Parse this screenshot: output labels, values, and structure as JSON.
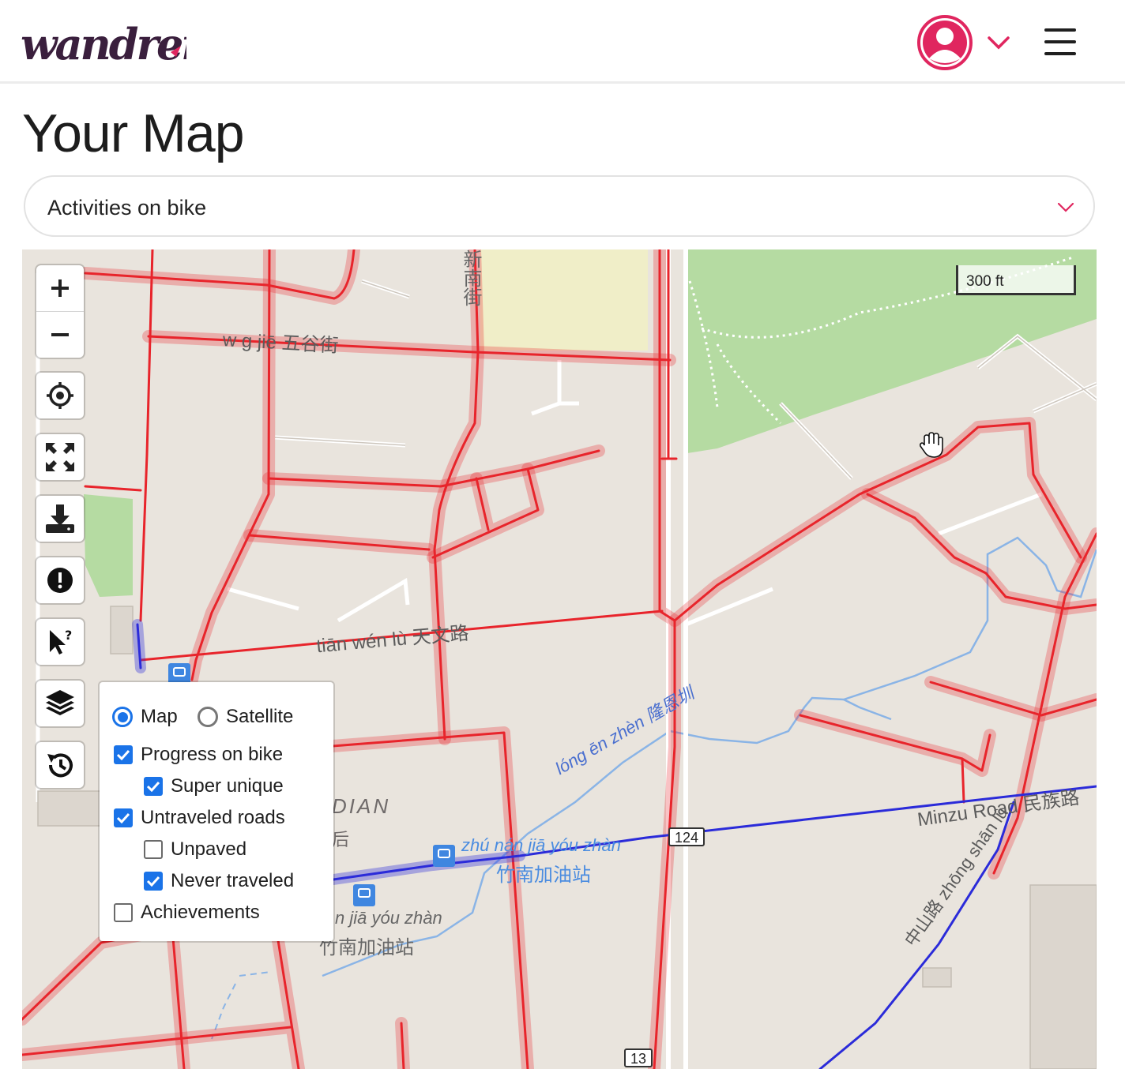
{
  "header": {
    "logo_text": "wandrer",
    "brand_color": "#3a1f3d",
    "accent_color": "#e0265f",
    "avatar_icon": "user-circle-icon",
    "menu_icon": "hamburger-icon"
  },
  "page": {
    "title": "Your Map"
  },
  "activity_select": {
    "value": "Activities on bike"
  },
  "map": {
    "scale_label": "300 ft",
    "controls": [
      {
        "name": "zoom-in",
        "icon": "plus-icon"
      },
      {
        "name": "zoom-out",
        "icon": "minus-icon"
      },
      {
        "name": "locate",
        "icon": "crosshair-icon"
      },
      {
        "name": "fullscreen",
        "icon": "expand-icon"
      },
      {
        "name": "download",
        "icon": "download-icon"
      },
      {
        "name": "report",
        "icon": "alert-icon"
      },
      {
        "name": "select-help",
        "icon": "cursor-question-icon"
      },
      {
        "name": "layers",
        "icon": "layers-icon"
      },
      {
        "name": "history",
        "icon": "history-icon"
      }
    ],
    "labels": {
      "street_xinnan": "新南街",
      "street_wugu": "w g jiē 五谷街",
      "street_tianwen": "tiān wén lù 天文路",
      "canal_longen": "lóng ēn zhèn 隆恩圳",
      "road_minzu": "Minzu Road 民族路",
      "station_pinyin": "zhú nán jiā yóu zhàn",
      "station_han": "竹南加油站",
      "station_pinyin_2": "n jiā yóu zhàn",
      "station_han_2": "竹南加油站",
      "district_fragment": "DIAN",
      "district_char": "后",
      "road_diagonal": "中山路 zhōng shān lù",
      "shield_124": "124",
      "shield_13": "13"
    },
    "colors": {
      "untraveled": "#e8242b",
      "progress": "#2b2bd9",
      "park": "#b5dba2",
      "land": "#e9e4dd",
      "water": "#8ab4e6"
    }
  },
  "layers_panel": {
    "base_options": [
      {
        "label": "Map",
        "selected": true
      },
      {
        "label": "Satellite",
        "selected": false
      }
    ],
    "overlays": [
      {
        "label": "Progress on bike",
        "checked": true,
        "indent": 0
      },
      {
        "label": "Super unique",
        "checked": true,
        "indent": 1
      },
      {
        "label": "Untraveled roads",
        "checked": true,
        "indent": 0
      },
      {
        "label": "Unpaved",
        "checked": false,
        "indent": 1
      },
      {
        "label": "Never traveled",
        "checked": true,
        "indent": 1
      },
      {
        "label": "Achievements",
        "checked": false,
        "indent": 0
      }
    ]
  }
}
